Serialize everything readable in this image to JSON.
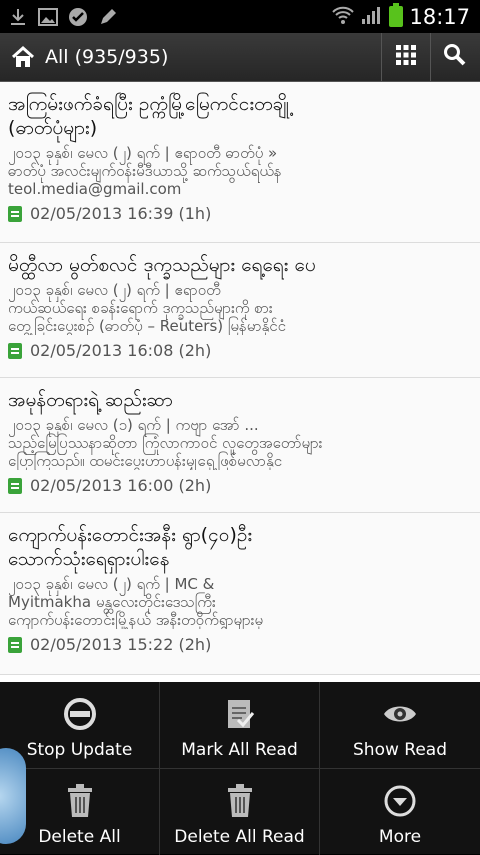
{
  "statusbar": {
    "time": "18:17"
  },
  "actionbar": {
    "title": "All (935/935)",
    "icons": [
      "home-icon",
      "grid-icon",
      "search-icon"
    ]
  },
  "articles": [
    {
      "title": "အကြမ်းဖက်ခံရပြီး ဥက္ကံမြို့မြေကင်ငးတချို့\n(ဓာတ်ပုံများ)",
      "snippet": "၂၀၁၃ ခုနှစ်၊ မေလ (၂) ရက် | ဧရာဝတီ ဓာတ်ပုံ »\nဓာတ်ပုံ အလင်းမျက်ဝန်းမီဒီယာသို့ ဆက်သွယ်ရယ်န\nteol.media@gmail.com",
      "date": "02/05/2013 16:39 (1h)"
    },
    {
      "title": "မိတ္ထီလာ မွတ်စလင် ဒုက္ခသည်များ ရေ့ရေး ပေ",
      "snippet": "၂၀၁၃ ခုနှစ်၊ မေလ (၂) ရက် | ဧရာဝတီ\nကယ်ဆယ်ရေး စခန်းရောက် ဒုက္ခသည်များကို စား\nတွေ့ခြင်းပွေးစဉ် (ဓာတ်ပုံ – Reuters) မြန်မာနိုင်ငံ",
      "date": "02/05/2013 16:08 (2h)"
    },
    {
      "title": "အမုန်တရားရဲ့ ဆည်းဆာ",
      "snippet": "၂၀၁၃ ခုနှစ်၊ မေလ (၁) ရက် | ကဗျာ အော် ...\nသည့်မြေပြဿနာဆိုတာ ကြုံလာကာဝင် လူတွေအတော်များ\nပြောကြသည်။ ထမင်းပွေးဟာပန်းမျှရှေ့ဖြစ်မလာနိုင",
      "date": "02/05/2013 16:00 (2h)"
    },
    {
      "title": "ကျောက်ပန်းတောင်းအနီး ရွာ(၄၀)ဦး\nသောက်သုံးရေရှားပါးနေ",
      "snippet": "၂၀၁၃ ခုနှစ်၊ မေလ (၂) ရက် | MC &\nMyitmakha မန္တလေးတိုင်းဒေသကြီး\nကျောက်ပန်းတောင်းမြို့နယ် အနီးတဝိုက်ရွာများမှ",
      "date": "02/05/2013 15:22 (2h)"
    }
  ],
  "menu": {
    "items": [
      {
        "label": "Stop Update",
        "icon": "stop-update-icon"
      },
      {
        "label": "Mark All Read",
        "icon": "mark-all-read-icon"
      },
      {
        "label": "Show Read",
        "icon": "eye-icon"
      },
      {
        "label": "Delete All",
        "icon": "trash-icon"
      },
      {
        "label": "Delete All Read",
        "icon": "trash-icon"
      },
      {
        "label": "More",
        "icon": "more-icon"
      }
    ]
  },
  "colors": {
    "actionbar": "#2e2e2e",
    "accent": "#3aa33a",
    "battery": "#58c21c"
  }
}
